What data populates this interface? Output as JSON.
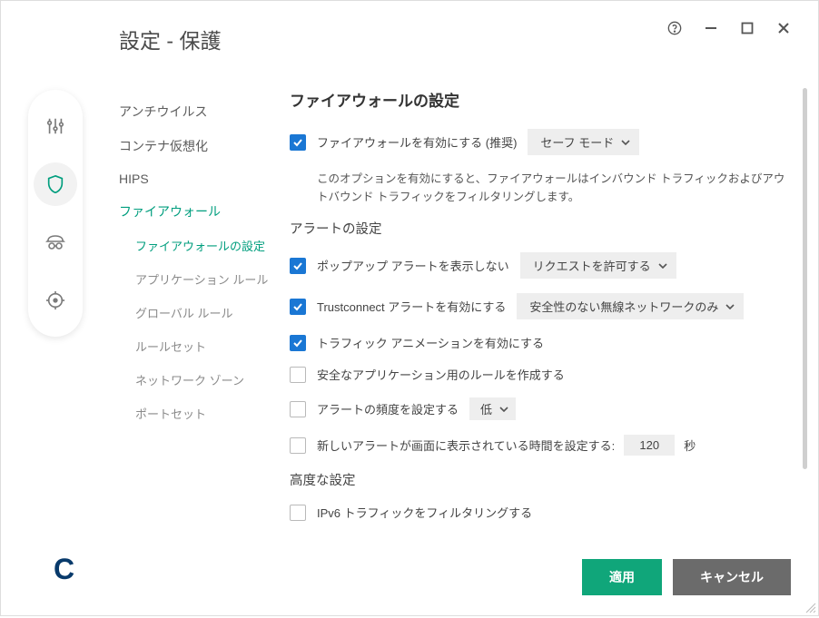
{
  "window": {
    "title": "設定 - 保護"
  },
  "nav": {
    "items": [
      "アンチウイルス",
      "コンテナ仮想化",
      "HIPS",
      "ファイアウォール"
    ],
    "sub": [
      "ファイアウォールの設定",
      "アプリケーション ルール",
      "グローバル ルール",
      "ルールセット",
      "ネットワーク ゾーン",
      "ポートセット"
    ]
  },
  "main": {
    "heading": "ファイアウォールの設定",
    "enable_label": "ファイアウォールを有効にする (推奨)",
    "mode_dd": "セーフ モード",
    "enable_desc": "このオプションを有効にすると、ファイアウォールはインバウンド トラフィックおよびアウトバウンド トラフィックをフィルタリングします。",
    "alert_heading": "アラートの設定",
    "popup_label": "ポップアップ アラートを表示しない",
    "popup_dd": "リクエストを許可する",
    "trustconnect_label": "Trustconnect アラートを有効にする",
    "trustconnect_dd": "安全性のない無線ネットワークのみ",
    "animation_label": "トラフィック アニメーションを有効にする",
    "safeapp_label": "安全なアプリケーション用のルールを作成する",
    "freq_label": "アラートの頻度を設定する",
    "freq_dd": "低",
    "duration_label": "新しいアラートが画面に表示されている時間を設定する:",
    "duration_value": "120",
    "duration_unit": "秒",
    "advanced_heading": "高度な設定",
    "ipv6_label": "IPv6 トラフィックをフィルタリングする"
  },
  "buttons": {
    "apply": "適用",
    "cancel": "キャンセル"
  },
  "logo": "C"
}
